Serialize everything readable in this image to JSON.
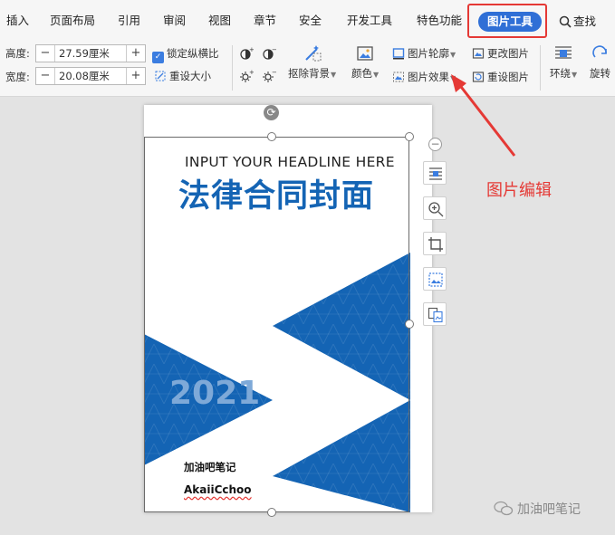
{
  "tabs": [
    "插入",
    "页面布局",
    "引用",
    "审阅",
    "视图",
    "章节",
    "安全",
    "开发工具",
    "特色功能"
  ],
  "active_tab": "图片工具",
  "find_label": "查找",
  "size": {
    "height_label": "高度:",
    "height_value": "27.59厘米",
    "width_label": "宽度:",
    "width_value": "20.08厘米",
    "minus": "−",
    "plus": "+"
  },
  "lock_ratio_label": "锁定纵横比",
  "reset_size_label": "重设大小",
  "remove_bg_label": "抠除背景",
  "color_label": "颜色",
  "outline_label": "图片轮廓",
  "effect_label": "图片效果",
  "change_pic_label": "更改图片",
  "reset_pic_label": "重设图片",
  "wrap_label": "环绕",
  "rotate_label": "旋转",
  "document": {
    "headline": "INPUT YOUR HEADLINE HERE",
    "title": "法律合同封面",
    "year": "2021",
    "brand_cn": "加油吧笔记",
    "brand_en": "AkaiiCchoo"
  },
  "annotation": "图片编辑",
  "watermark": "加油吧笔记",
  "colors": {
    "accent_blue": "#2f6fd6",
    "triangle_blue": "#1464b4",
    "annotation_red": "#e53935"
  }
}
